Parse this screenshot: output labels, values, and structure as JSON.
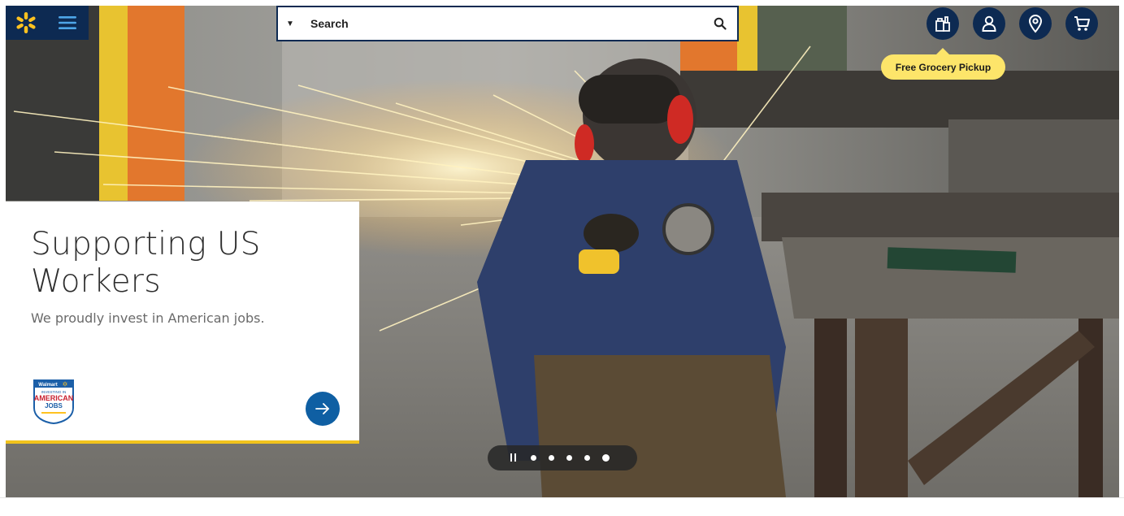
{
  "header": {
    "search": {
      "placeholder": "Search"
    },
    "tooltip": {
      "text": "Free Grocery Pickup"
    },
    "actions": [
      {
        "name": "grocery-pickup",
        "icon": "grocery-bag-icon"
      },
      {
        "name": "account",
        "icon": "user-icon"
      },
      {
        "name": "store-finder",
        "icon": "location-pin-icon"
      },
      {
        "name": "cart",
        "icon": "cart-icon"
      }
    ]
  },
  "hero": {
    "title": "Supporting US Workers",
    "subtitle": "We proudly invest in American jobs.",
    "badge": {
      "brand": "Walmart",
      "line1": "INVESTING IN",
      "line2": "AMERICAN",
      "line3": "JOBS"
    }
  },
  "carousel": {
    "slide_count": 5,
    "active_slide": 5
  },
  "colors": {
    "brand_navy": "#0d2a52",
    "spark_yellow": "#ffc220",
    "accent_blue": "#0f5fa3",
    "tooltip_yellow": "#fde56a",
    "card_underline": "#f2c31c"
  }
}
